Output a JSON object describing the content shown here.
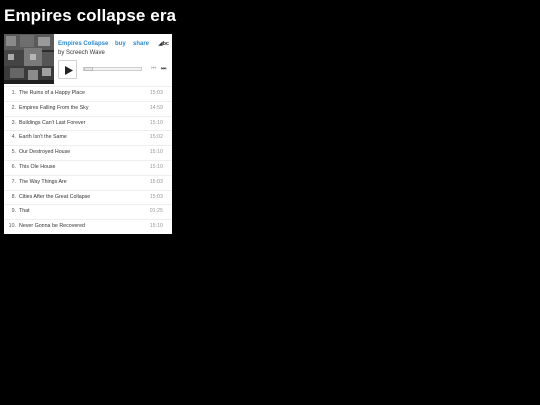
{
  "page": {
    "title": "Empires collapse era"
  },
  "player": {
    "album_title": "Empires Collapse",
    "buy_label": "buy",
    "share_label": "share",
    "logo_text": "◢bc",
    "artist_line": "by Screech Wave",
    "progress": 0,
    "colors": {
      "link": "#2b8ad6",
      "background": "#ffffff",
      "page_background": "#000000"
    },
    "icons": {
      "play": "play-icon",
      "prev": "prev-track-icon",
      "next": "next-track-icon"
    },
    "prev_glyph": "⏮",
    "next_glyph": "⏭"
  },
  "tracks": [
    {
      "num": "1.",
      "title": "The Ruins of a Happy Place",
      "duration": "15:03"
    },
    {
      "num": "2.",
      "title": "Empires Falling From the Sky",
      "duration": "14:59"
    },
    {
      "num": "3.",
      "title": "Buildings Can't Last Forever",
      "duration": "15:10"
    },
    {
      "num": "4.",
      "title": "Earth Isn't the Same",
      "duration": "15:02"
    },
    {
      "num": "5.",
      "title": "Our Destroyed House",
      "duration": "15:10"
    },
    {
      "num": "6.",
      "title": "This Ole House",
      "duration": "15:10"
    },
    {
      "num": "7.",
      "title": "The Way Things Are",
      "duration": "15:03"
    },
    {
      "num": "8.",
      "title": "Cities After the Great Collapse",
      "duration": "15:03"
    },
    {
      "num": "9.",
      "title": "That",
      "duration": "01:25"
    },
    {
      "num": "10.",
      "title": "Never Gonna be Recovered",
      "duration": "15:10"
    }
  ]
}
